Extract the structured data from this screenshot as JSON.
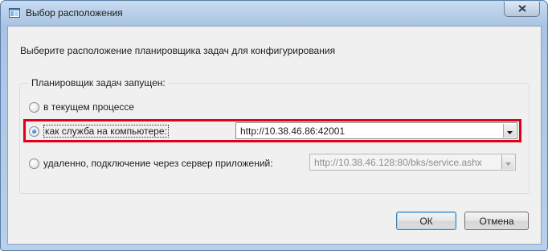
{
  "window": {
    "title": "Выбор расположения"
  },
  "dialog": {
    "description": "Выберите расположение планировщика задач для конфигурирования",
    "group_caption": "Планировщик задач запущен:",
    "options": [
      {
        "label": "в текущем процессе",
        "checked": false
      },
      {
        "label": "как служба на компьютере:",
        "checked": true,
        "value": "http://10.38.46.86:42001"
      },
      {
        "label": "удаленно, подключение через сервер приложений:",
        "checked": false,
        "value": "http://10.38.46.128:80/bks/service.ashx",
        "disabled": true
      }
    ],
    "ok_label": "ОК",
    "cancel_label": "Отмена"
  },
  "colors": {
    "highlight": "#e0001a",
    "title_gradient": "#a9c4e3",
    "client_bg": "#f0f0f0"
  },
  "icons": [
    "window-icon",
    "close-icon",
    "chevron-down-icon"
  ]
}
